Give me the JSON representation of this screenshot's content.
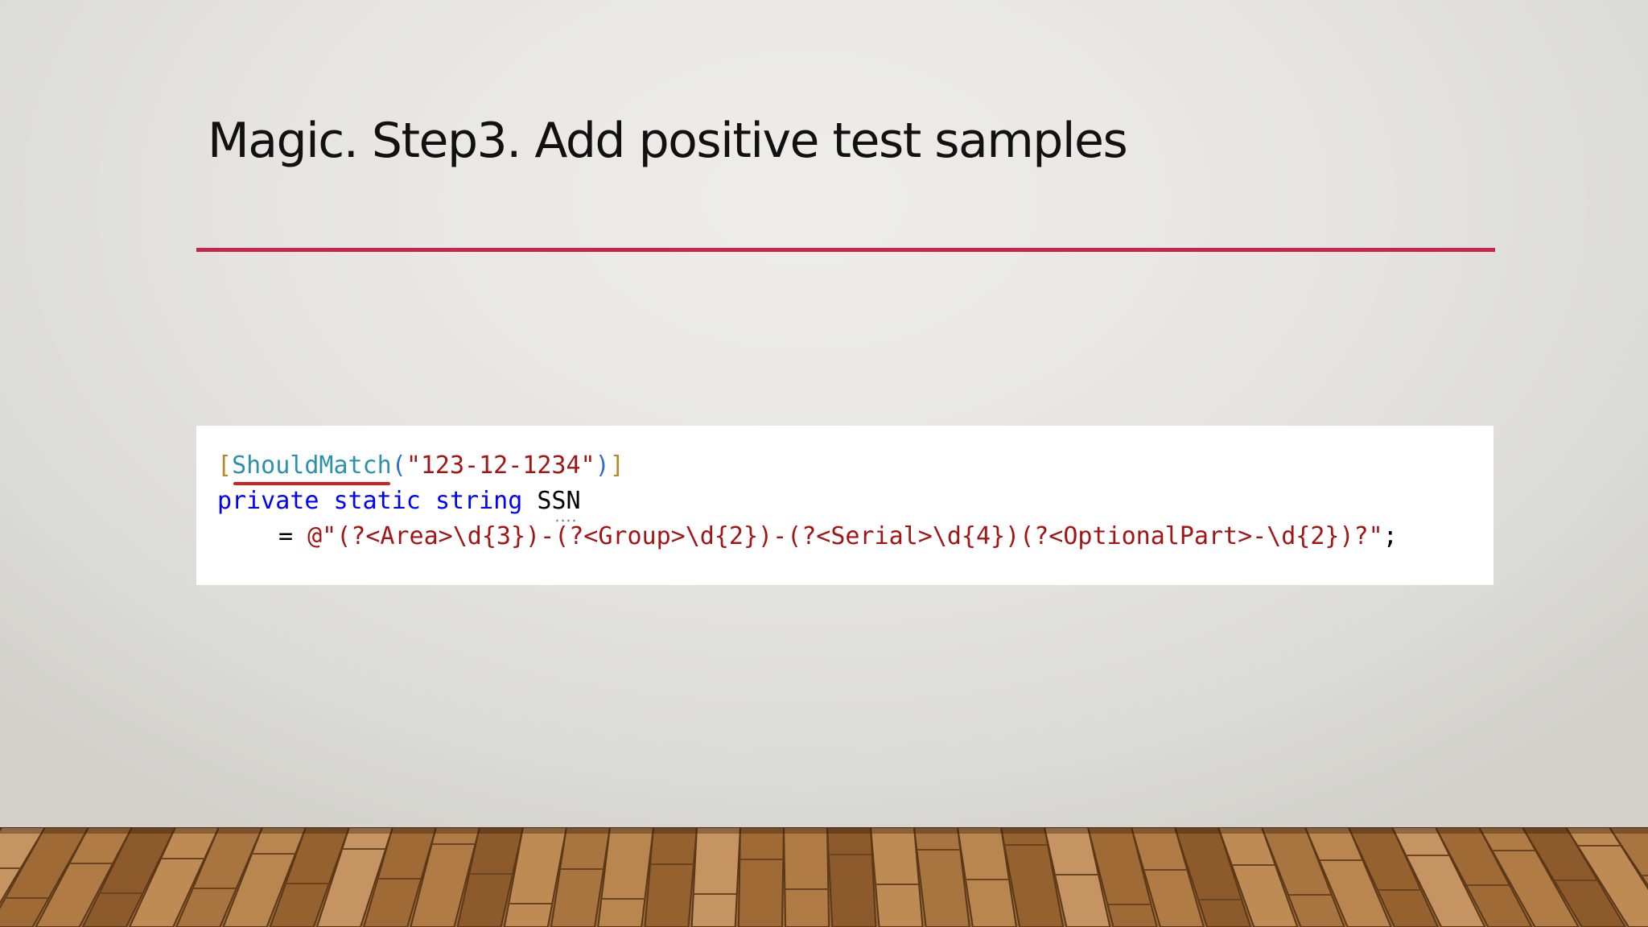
{
  "slide": {
    "title": "Magic. Step3. Add positive test samples",
    "accent_color": "#c8254a"
  },
  "code": {
    "line1": {
      "open_bracket": "[",
      "attribute": "ShouldMatch",
      "open_paren": "(",
      "string": "\"123-12-1234\"",
      "close_paren": ")",
      "close_bracket": "]"
    },
    "line2": {
      "kw_private": "private",
      "kw_static": "static",
      "kw_string": "string",
      "identifier": "SSN"
    },
    "line3": {
      "equals": "=",
      "verbatim_string": "@\"(?<Area>\\d{3})-(?<Group>\\d{2})-(?<Serial>\\d{4})(?<OptionalPart>-\\d{2})?\"",
      "semicolon": ";"
    },
    "colors": {
      "keyword": "#0000ff",
      "attribute": "#2b91af",
      "string": "#a31515"
    }
  }
}
